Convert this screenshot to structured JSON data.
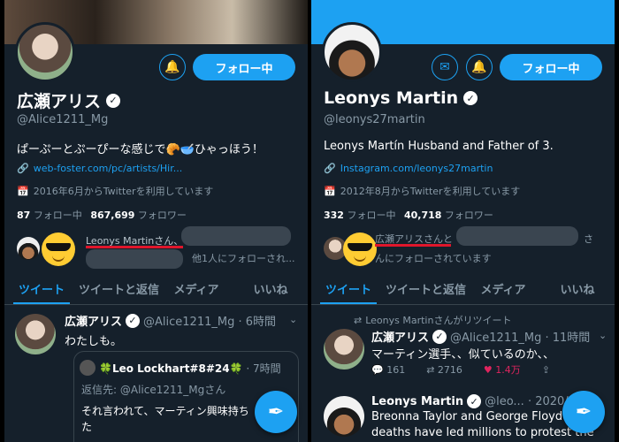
{
  "left": {
    "follow_label": "フォロー中",
    "name": "広瀬アリス",
    "handle": "@Alice1211_Mg",
    "bio": "ぱーぷーとぷーぴーな感じで🥐🥣ひゃっほう！",
    "link": "web-foster.com/pc/artists/Hir...",
    "joined": "2016年6月からTwitterを利用しています",
    "following_count": "87",
    "following_label": "フォロー中",
    "followers_count": "867,699",
    "followers_label": "フォロワー",
    "followed_by_name": "Leonys Martinさん、",
    "followed_by_rest": "他1人にフォローされ...",
    "tabs": [
      "ツイート",
      "ツイートと返信",
      "メディア",
      "いいね"
    ],
    "tweet": {
      "name": "広瀬アリス",
      "handle_time": "@Alice1211_Mg · 6時間",
      "text": "わたしも。",
      "quote_author": "🍀Leo Lockhart#8#24🍀",
      "quote_time": "· 7時間",
      "quote_reply": "返信先: @Alice1211_Mgさん",
      "quote_text_1": "それ言われて、マーティン興味持ち",
      "quote_text_2": "た"
    }
  },
  "right": {
    "follow_label": "フォロー中",
    "name": "Leonys Martin",
    "handle": "@leonys27martin",
    "bio": "Leonys Martín Husband and Father of 3.",
    "link": "Instagram.com/leonys27martin",
    "joined": "2012年8月からTwitterを利用しています",
    "following_count": "332",
    "following_label": "フォロー中",
    "followers_count": "40,718",
    "followers_label": "フォロワー",
    "followed_by_name": "広瀬アリスさんと",
    "followed_by_tail": "さ",
    "followed_by_rest": "んにフォローされています",
    "tabs": [
      "ツイート",
      "ツイートと返信",
      "メディア",
      "いいね"
    ],
    "retweet_label": "Leonys Martinさんがリツイート",
    "tweet": {
      "name": "広瀬アリス",
      "handle_time": "@Alice1211_Mg · 11時間",
      "text": "マーティン選手、、似ているのか、、",
      "replies": "161",
      "retweets": "2716",
      "likes": "1.4万"
    },
    "tweet2": {
      "name": "Leonys Martin",
      "handle_time": "@leo... · 2020/09/",
      "text_1": "Breonna Taylor and George Floyd's",
      "text_2": "deaths have led millions to protest the"
    }
  },
  "colors": {
    "accent": "#1da1f2",
    "background": "#15202b",
    "like": "#e0245e",
    "underline": "#e0162b"
  }
}
